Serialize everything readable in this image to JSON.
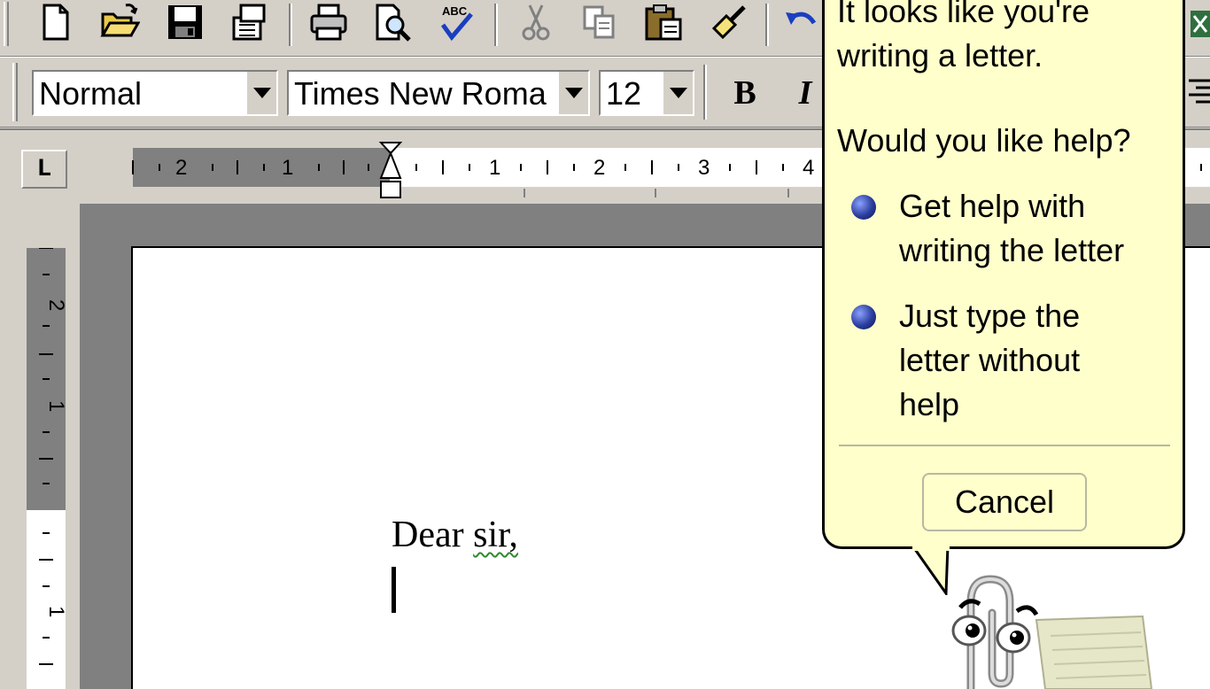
{
  "toolbar": {
    "standard": [
      {
        "icon": "new-document-icon"
      },
      {
        "icon": "open-folder-icon"
      },
      {
        "icon": "save-disk-icon"
      },
      {
        "icon": "permission-icon"
      },
      {
        "icon": "print-icon"
      },
      {
        "icon": "print-preview-icon"
      },
      {
        "icon": "spelling-grammar-icon",
        "text": "ABC"
      },
      {
        "icon": "cut-scissors-icon"
      },
      {
        "icon": "copy-icon"
      },
      {
        "icon": "paste-clipboard-icon"
      },
      {
        "icon": "format-painter-icon"
      },
      {
        "icon": "undo-icon"
      }
    ],
    "formatting": {
      "style_value": "Normal",
      "font_value": "Times New Roma",
      "size_value": "12",
      "bold_label": "B",
      "italic_label": "I"
    }
  },
  "rulers": {
    "horizontal_labels": [
      "2",
      "1",
      "1",
      "2",
      "3",
      "4"
    ],
    "vertical_labels": [
      "2",
      "1",
      "1"
    ],
    "tab_selector_symbol": "L"
  },
  "document": {
    "greeting_word1": "Dear",
    "greeting_word2": "sir,"
  },
  "assistant": {
    "intro": "It looks like you're writing a letter.",
    "intro_line1": "It looks like you're",
    "intro_line2": "writing a letter.",
    "question": "Would you like help?",
    "options": [
      {
        "lines": [
          "Get help with",
          "writing the letter"
        ]
      },
      {
        "lines": [
          "Just type the",
          "letter without",
          "help"
        ]
      }
    ],
    "cancel_label": "Cancel"
  },
  "colors": {
    "chrome": "#d4d0c8",
    "balloon": "#ffffcc",
    "workspace": "#808080",
    "spell_squiggle": "#2e8b2e"
  }
}
